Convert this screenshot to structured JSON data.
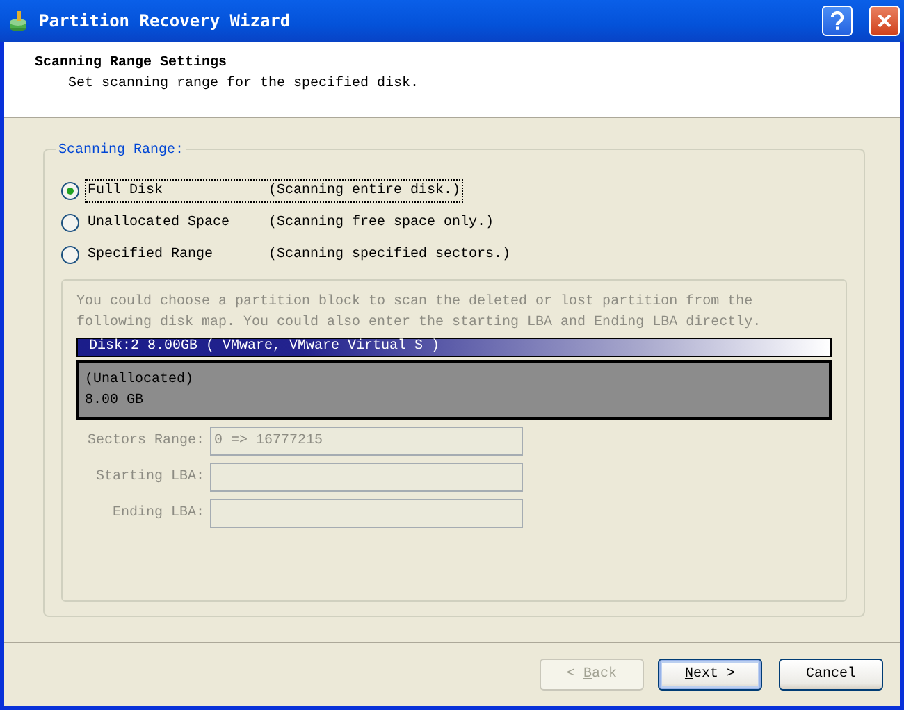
{
  "window": {
    "title": "Partition Recovery Wizard"
  },
  "header": {
    "title": "Scanning Range Settings",
    "subtitle": "Set scanning range for the specified disk."
  },
  "group": {
    "legend": "Scanning Range:",
    "options": [
      {
        "label": "Full Disk",
        "description": "(Scanning entire disk.)",
        "selected": true
      },
      {
        "label": "Unallocated Space",
        "description": "(Scanning free space only.)",
        "selected": false
      },
      {
        "label": "Specified Range",
        "description": "(Scanning specified sectors.)",
        "selected": false
      }
    ]
  },
  "range_panel": {
    "disabled": true,
    "hint": "You could choose a partition block to scan the deleted or lost partition from the following disk map. You could also enter the starting LBA and Ending LBA directly.",
    "disk_header": "Disk:2 8.00GB  ( VMware, VMware Virtual S )",
    "partition": {
      "label": "(Unallocated)",
      "size": "8.00 GB"
    },
    "fields": [
      {
        "label": "Sectors Range:",
        "value": "0 => 16777215"
      },
      {
        "label": "Starting LBA:"
      },
      {
        "label": "Ending LBA:"
      }
    ]
  },
  "buttons": [
    {
      "label": "ack",
      "label_before": "< ",
      "access_key": "B",
      "disabled": true,
      "default": false
    },
    {
      "label": "ext >",
      "access_key": "N",
      "disabled": false,
      "default": true
    },
    {
      "label": "Cancel",
      "disabled": false,
      "default": false
    }
  ]
}
